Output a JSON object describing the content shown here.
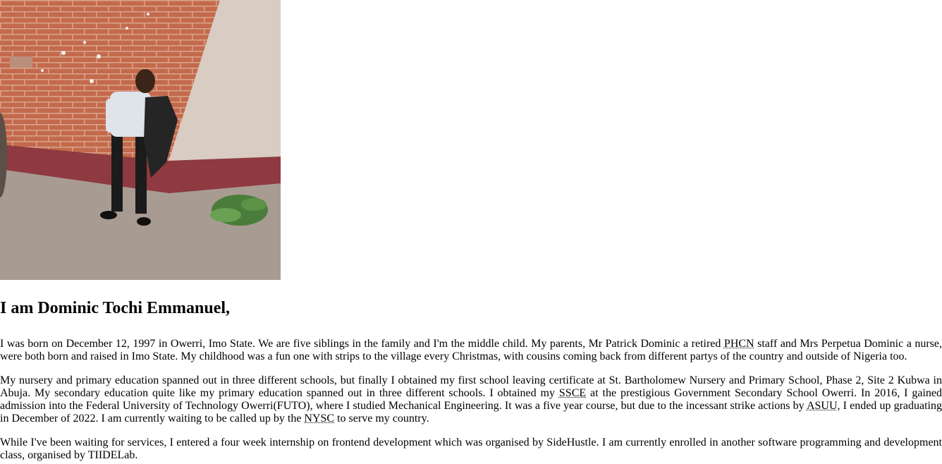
{
  "profile": {
    "heading": "I am Dominic Tochi Emmanuel,",
    "p1": {
      "a": "I was born on December 12, 1997 in Owerri, Imo State. We are five siblings in the family and I'm the middle child. My parents, Mr Patrick Dominic a retired ",
      "abbr1": "PHCN",
      "b": " staff and Mrs Perpetua Dominic a nurse, were both born and raised in Imo State. My childhood was a fun one with strips to the village every Christmas, with cousins coming back from different partys of the country and outside of Nigeria too."
    },
    "p2": {
      "a": "My nursery and primary education spanned out in three different schools, but finally I obtained my first school leaving certificate at St. Bartholomew Nursery and Primary School, Phase 2, Site 2 Kubwa in Abuja. My secondary education quite like my primary education spanned out in three different schools. I obtained my ",
      "abbr1": "SSCE",
      "b": " at the prestigious Government Secondary School Owerri. In 2016, I gained admission into the Federal University of Technology Owerri(FUTO), where I studied Mechanical Engineering. It was a five year course, but due to the incessant strike actions by ",
      "abbr2": "ASUU",
      "c": ", I ended up graduating in December of 2022. I am currently waiting to be called up by the ",
      "abbr3": "NYSC",
      "d": " to serve my country."
    },
    "p3": "While I've been waiting for services, I entered a four week internship on frontend development which was organised by SideHustle. I am currently enrolled in another software programming and development class, organised by TIIDELab."
  }
}
